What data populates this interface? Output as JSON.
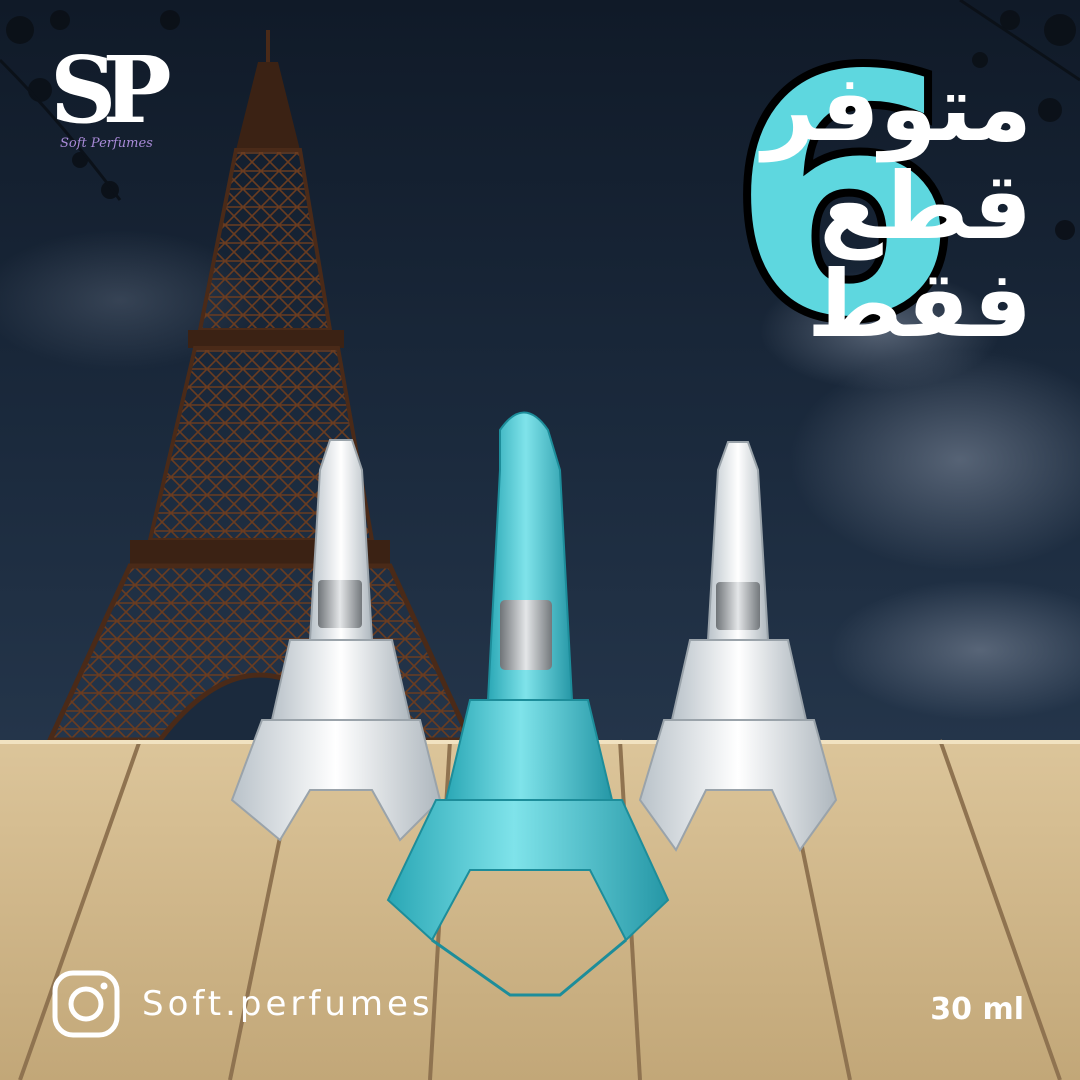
{
  "brand": {
    "logo_letters": "SP",
    "logo_script": "Soft Perfumes"
  },
  "headline": {
    "lines": [
      "متوفر",
      "قطع",
      "فقط"
    ],
    "number": "6"
  },
  "footer": {
    "instagram_icon": "instagram-icon",
    "handle": "Soft.perfumes",
    "volume": "30 ml"
  },
  "colors": {
    "sky_dark": "#14202f",
    "tower": "#4a2a18",
    "wood": "#cfb68a",
    "accent": "#5ed7df",
    "blue_bottle": "#46c3cf",
    "clear_bottle": "#e9eef2"
  }
}
